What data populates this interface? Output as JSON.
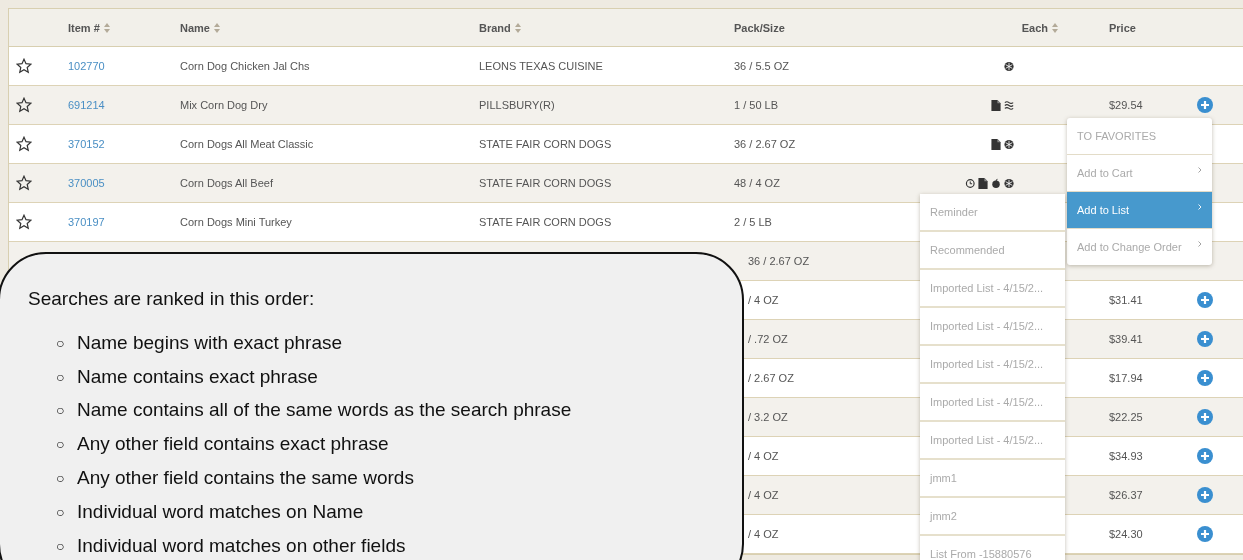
{
  "table": {
    "columns": [
      {
        "label": "Item #",
        "sortable": true
      },
      {
        "label": "Name",
        "sortable": true
      },
      {
        "label": "Brand",
        "sortable": true
      },
      {
        "label": "Pack/Size",
        "sortable": false
      },
      {
        "label": "Each",
        "sortable": true
      },
      {
        "label": "Price",
        "sortable": false
      }
    ],
    "rows": [
      {
        "kind": "item",
        "item": "102770",
        "name": "Corn Dog Chicken Jal Chs",
        "brand": "LEONS TEXAS CUISINE",
        "pack": "36 / 5.5 OZ",
        "icons": [
          {
            "kind": "snowflake"
          }
        ]
      },
      {
        "kind": "item",
        "item": "691214",
        "name": "Mix Corn Dog Dry",
        "brand": "PILLSBURY(R)",
        "pack": "1 / 50 LB",
        "icons": [
          {
            "kind": "document"
          },
          {
            "kind": "waves"
          }
        ],
        "price": "$29.54"
      },
      {
        "kind": "item",
        "item": "370152",
        "name": "Corn Dogs All Meat Classic",
        "brand": "STATE FAIR CORN DOGS",
        "pack": "36 / 2.67 OZ",
        "icons": [
          {
            "kind": "document"
          },
          {
            "kind": "snowflake"
          }
        ]
      },
      {
        "kind": "item",
        "item": "370005",
        "name": "Corn Dogs All Beef",
        "brand": "STATE FAIR CORN DOGS",
        "pack": "48 / 4 OZ",
        "icons": [
          {
            "kind": "clock"
          },
          {
            "kind": "document"
          },
          {
            "kind": "apple"
          },
          {
            "kind": "snowflake"
          }
        ]
      },
      {
        "kind": "item",
        "item": "370197",
        "name": "Corn Dogs Mini Turkey",
        "brand": "STATE FAIR CORN DOGS",
        "pack": "2 / 5 LB",
        "icons": []
      },
      {
        "kind": "covered",
        "pack": "36 / 2.67 OZ"
      },
      {
        "kind": "covered",
        "pack": "/ 4 OZ",
        "price": "$31.41"
      },
      {
        "kind": "covered",
        "pack": "/ .72 OZ",
        "price": "$39.41"
      },
      {
        "kind": "covered",
        "pack": "/ 2.67 OZ",
        "price": "$17.94"
      },
      {
        "kind": "covered",
        "pack": "/ 3.2 OZ",
        "price": "$22.25"
      },
      {
        "kind": "covered",
        "pack": "/ 4 OZ",
        "price": "$34.93"
      },
      {
        "kind": "covered",
        "pack": "/ 4 OZ",
        "price": "$26.37"
      },
      {
        "kind": "covered",
        "pack": "/ 4 OZ",
        "price": "$24.30"
      }
    ]
  },
  "context_menu": {
    "header": "TO FAVORITES",
    "items": [
      {
        "label": "Add to Cart",
        "selected": false
      },
      {
        "label": "Add to List",
        "selected": true
      },
      {
        "label": "Add to Change Order",
        "selected": false
      }
    ]
  },
  "list_submenu": {
    "items": [
      "Reminder",
      "Recommended",
      "Imported List - 4/15/2...",
      "Imported List - 4/15/2...",
      "Imported List - 4/15/2...",
      "Imported List - 4/15/2...",
      "Imported List - 4/15/2...",
      "jmm1",
      "jmm2",
      "List From -15880576"
    ]
  },
  "callout": {
    "title": "Searches are ranked in this order:",
    "items": [
      {
        "marker": "○",
        "text": "Name begins with exact phrase"
      },
      {
        "marker": "○",
        "text": "Name contains exact phrase"
      },
      {
        "marker": "○",
        "text": "Name contains all of the same words as the search phrase"
      },
      {
        "marker": "○",
        "text": "Any other field contains exact phrase"
      },
      {
        "marker": "○",
        "text": "Any other field contains the same words"
      },
      {
        "marker": "○",
        "text": "Individual word matches on Name"
      },
      {
        "marker": "○",
        "text": "Individual word matches on other fields"
      }
    ]
  }
}
